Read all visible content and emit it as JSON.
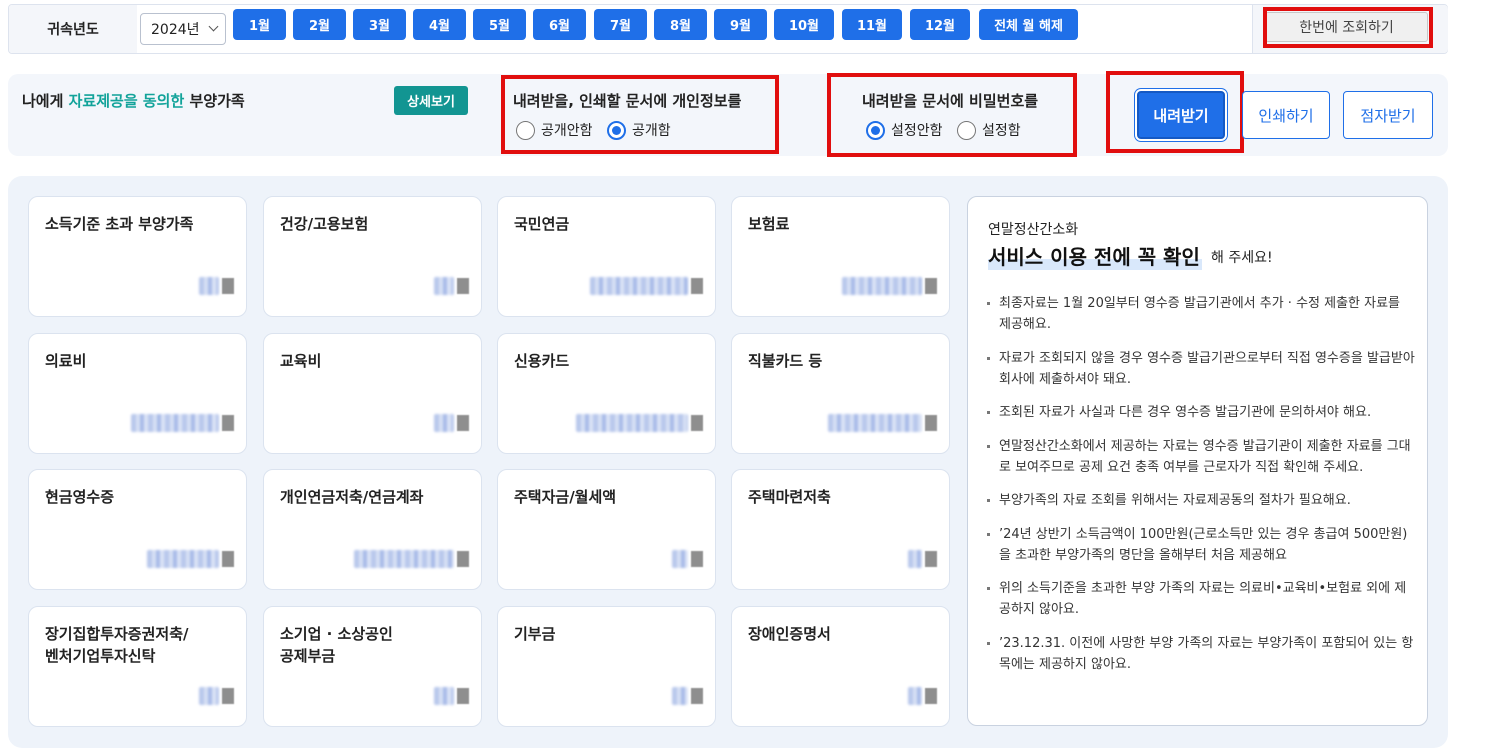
{
  "year_filter": {
    "label": "귀속년도",
    "selected_year": "2024년",
    "months": [
      "1월",
      "2월",
      "3월",
      "4월",
      "5월",
      "6월",
      "7월",
      "8월",
      "9월",
      "10월",
      "11월",
      "12월"
    ],
    "clear_all": "전체 월 해제",
    "query_all": "한번에 조회하기"
  },
  "consent": {
    "title_prefix": "나에게 ",
    "title_highlight": "자료제공을 동의한",
    "title_suffix": " 부양가족",
    "detail_button": "상세보기"
  },
  "personal_info_option": {
    "title": "내려받을, 인쇄할 문서에 개인정보를",
    "options": [
      "공개안함",
      "공개함"
    ],
    "selected": "공개함"
  },
  "password_option": {
    "title": "내려받을 문서에 비밀번호를",
    "options": [
      "설정안함",
      "설정함"
    ],
    "selected": "설정안함"
  },
  "actions": {
    "download": "내려받기",
    "print": "인쇄하기",
    "braille": "점자받기"
  },
  "cards": [
    {
      "title": "소득기준 초과 부양가족"
    },
    {
      "title": "건강/고용보험"
    },
    {
      "title": "국민연금"
    },
    {
      "title": "보험료"
    },
    {
      "title": "의료비"
    },
    {
      "title": "교육비"
    },
    {
      "title": "신용카드"
    },
    {
      "title": "직불카드 등"
    },
    {
      "title": "현금영수증"
    },
    {
      "title": "개인연금저축/연금계좌"
    },
    {
      "title": "주택자금/월세액"
    },
    {
      "title": "주택마련저축"
    },
    {
      "title": "장기집합투자증권저축/\n벤처기업투자신탁"
    },
    {
      "title": "소기업 · 소상공인\n공제부금"
    },
    {
      "title": "기부금"
    },
    {
      "title": "장애인증명서"
    }
  ],
  "notice": {
    "subtitle": "연말정산간소화",
    "title": "서비스 이용 전에 꼭 확인",
    "title_suffix": "해 주세요!",
    "items": [
      "최종자료는 1월 20일부터 영수증 발급기관에서 추가 · 수정 제출한 자료를 제공해요.",
      "자료가 조회되지 않을 경우 영수증 발급기관으로부터 직접 영수증을 발급받아 회사에 제출하셔야 돼요.",
      "조회된 자료가 사실과 다른 경우 영수증 발급기관에 문의하셔야 해요.",
      "연말정산간소화에서 제공하는 자료는 영수증 발급기관이 제출한 자료를 그대로 보여주므로 공제 요건 충족 여부를 근로자가 직접 확인해 주세요.",
      "부양가족의 자료 조회를 위해서는 자료제공동의 절차가 필요해요.",
      "’24년 상반기 소득금액이 100만원(근로소득만 있는 경우 총급여 500만원)을 초과한 부양가족의 명단을 올해부터 처음 제공해요",
      "위의 소득기준을 초과한 부양 가족의 자료는 의료비•교육비•보험료 외에 제공하지 않아요.",
      "’23.12.31. 이전에 사망한 부양 가족의 자료는 부양가족이 포함되어 있는 항목에는 제공하지 않아요."
    ]
  }
}
